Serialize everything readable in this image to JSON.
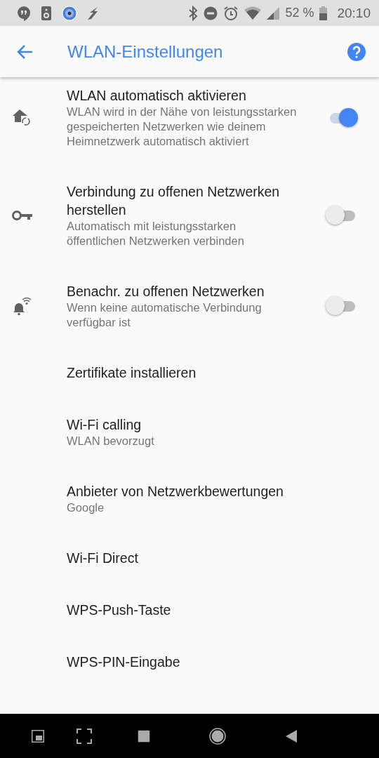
{
  "status_bar": {
    "battery": "52 %",
    "time": "20:10"
  },
  "app_bar": {
    "title": "WLAN-Einstellungen"
  },
  "settings": [
    {
      "kind": "toggle",
      "title": "WLAN automatisch aktivieren",
      "summary": "WLAN wird in der Nähe von leistungsstarken gespeicherten Netzwerken wie deinem Heimnetzwerk automatisch aktiviert",
      "on": true
    },
    {
      "kind": "toggle",
      "title": "Verbindung zu offenen Netzwerken herstellen",
      "summary": "Automatisch mit leistungsstarken öffentlichen Netzwerken verbinden",
      "on": false
    },
    {
      "kind": "toggle",
      "title": "Benachr. zu offenen Netzwerken",
      "summary": "Wenn keine automatische Verbindung verfügbar ist",
      "on": false
    },
    {
      "kind": "plain",
      "title": "Zertifikate installieren"
    },
    {
      "kind": "plain",
      "title": "Wi-Fi calling",
      "summary": "WLAN bevorzugt"
    },
    {
      "kind": "plain",
      "title": "Anbieter von Netzwerkbewertungen",
      "summary": "Google"
    },
    {
      "kind": "plain",
      "title": "Wi-Fi Direct"
    },
    {
      "kind": "plain",
      "title": "WPS-Push-Taste"
    },
    {
      "kind": "plain",
      "title": "WPS-PIN-Eingabe"
    }
  ]
}
